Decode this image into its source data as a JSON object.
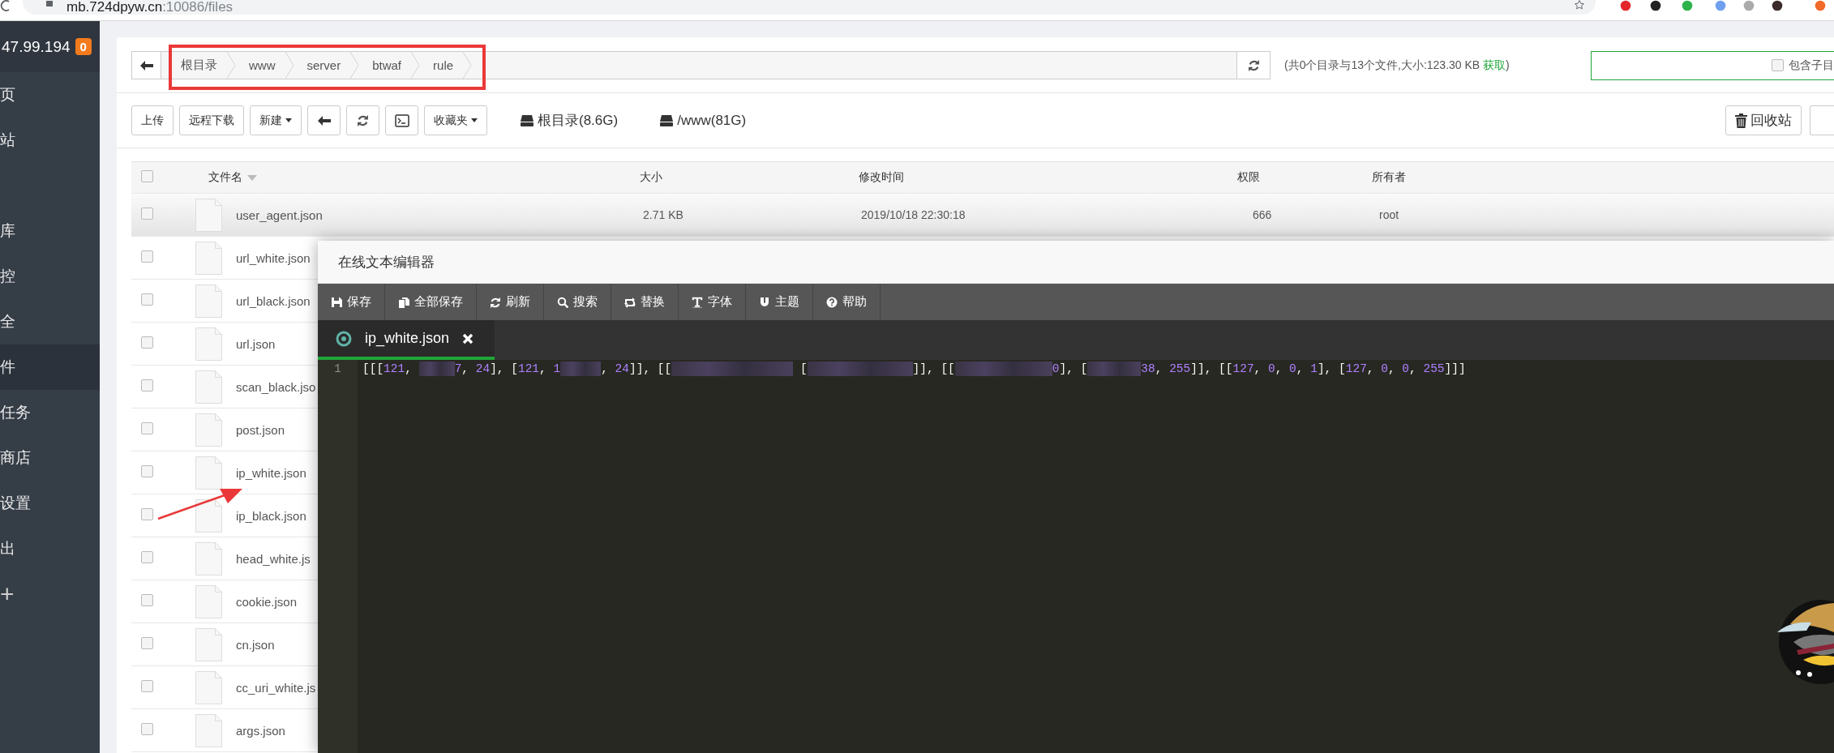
{
  "browser": {
    "url_host": "mb.724dpyw.cn",
    "url_path": ":10086/files"
  },
  "sidebar": {
    "server": "47.99.194",
    "badge": "0",
    "add": "+",
    "items": [
      {
        "label": "页",
        "selected": false
      },
      {
        "label": "站",
        "selected": false
      },
      {
        "label": "库",
        "selected": false
      },
      {
        "label": "控",
        "selected": false
      },
      {
        "label": "全",
        "selected": false
      },
      {
        "label": "件",
        "selected": true
      },
      {
        "label": "任务",
        "selected": false
      },
      {
        "label": "商店",
        "selected": false
      },
      {
        "label": "设置",
        "selected": false
      },
      {
        "label": "出",
        "selected": false
      }
    ]
  },
  "path_bar": {
    "crumbs": [
      "根目录",
      "www",
      "server",
      "btwaf",
      "rule"
    ],
    "info_prefix": "(共0个目录与13个文件,大小:123.30 KB ",
    "info_link": "获取",
    "info_suffix": ")",
    "subdir": {
      "label": "包含子目",
      "checked": false
    }
  },
  "toolbar": {
    "buttons": [
      {
        "kind": "text",
        "label": "上传"
      },
      {
        "kind": "text",
        "label": "远程下载"
      },
      {
        "kind": "menu",
        "label": "新建"
      },
      {
        "kind": "back"
      },
      {
        "kind": "refresh"
      },
      {
        "kind": "terminal"
      },
      {
        "kind": "menu",
        "label": "收藏夹"
      }
    ],
    "disks": [
      "根目录(8.6G)",
      "/www(81G)"
    ],
    "recycle": "回收站"
  },
  "table": {
    "all_checked": false,
    "columns": [
      {
        "label": "文件名",
        "sorted": true
      },
      {
        "label": "大小",
        "sorted": false
      },
      {
        "label": "修改时间",
        "sorted": false
      },
      {
        "label": "权限",
        "sorted": false
      },
      {
        "label": "所有者",
        "sorted": false
      }
    ],
    "rows": [
      {
        "name": "user_agent.json",
        "size": "2.71 KB",
        "modified": "2019/10/18 22:30:18",
        "permission": "666",
        "owner": "root",
        "checked": false,
        "hovered": true
      },
      {
        "name": "url_white.json",
        "checked": false,
        "hovered": false
      },
      {
        "name": "url_black.json",
        "checked": false,
        "hovered": false
      },
      {
        "name": "url.json",
        "checked": false,
        "hovered": false
      },
      {
        "name": "scan_black.jso",
        "checked": false,
        "hovered": false
      },
      {
        "name": "post.json",
        "checked": false,
        "hovered": false
      },
      {
        "name": "ip_white.json",
        "checked": false,
        "hovered": false
      },
      {
        "name": "ip_black.json",
        "checked": false,
        "hovered": false
      },
      {
        "name": "head_white.js",
        "checked": false,
        "hovered": false
      },
      {
        "name": "cookie.json",
        "checked": false,
        "hovered": false
      },
      {
        "name": "cn.json",
        "checked": false,
        "hovered": false
      },
      {
        "name": "cc_uri_white.js",
        "checked": false,
        "hovered": false
      },
      {
        "name": "args.json",
        "checked": false,
        "hovered": false
      }
    ]
  },
  "editor": {
    "title": "在线文本编辑器",
    "tools": [
      {
        "kind": "save",
        "label": "保存"
      },
      {
        "kind": "save-all",
        "label": "全部保存"
      },
      {
        "kind": "refresh",
        "label": "刷新"
      },
      {
        "kind": "search",
        "label": "搜索"
      },
      {
        "kind": "replace",
        "label": "替换"
      },
      {
        "kind": "font",
        "label": "字体"
      },
      {
        "kind": "theme",
        "label": "主题"
      },
      {
        "kind": "help",
        "label": "帮助"
      }
    ],
    "tabs": [
      {
        "label": "ip_white.json",
        "selected": true
      }
    ],
    "lines": [
      {
        "number": "1",
        "segments": [
          {
            "kind": "text",
            "text": "[[[121, "
          },
          {
            "kind": "redacted"
          },
          {
            "kind": "text",
            "text": "7, 24], [121, 1"
          },
          {
            "kind": "redacted"
          },
          {
            "kind": "text",
            "text": ", 24]], [["
          },
          {
            "kind": "redacted"
          },
          {
            "kind": "text",
            "text": " ["
          },
          {
            "kind": "redacted"
          },
          {
            "kind": "text",
            "text": "]], [["
          },
          {
            "kind": "redacted"
          },
          {
            "kind": "text",
            "text": "0], ["
          },
          {
            "kind": "redacted"
          },
          {
            "kind": "text",
            "text": "38, 255]], [[127, 0, 0, 1], [127, 0, 0, 255]]]"
          }
        ]
      }
    ]
  }
}
